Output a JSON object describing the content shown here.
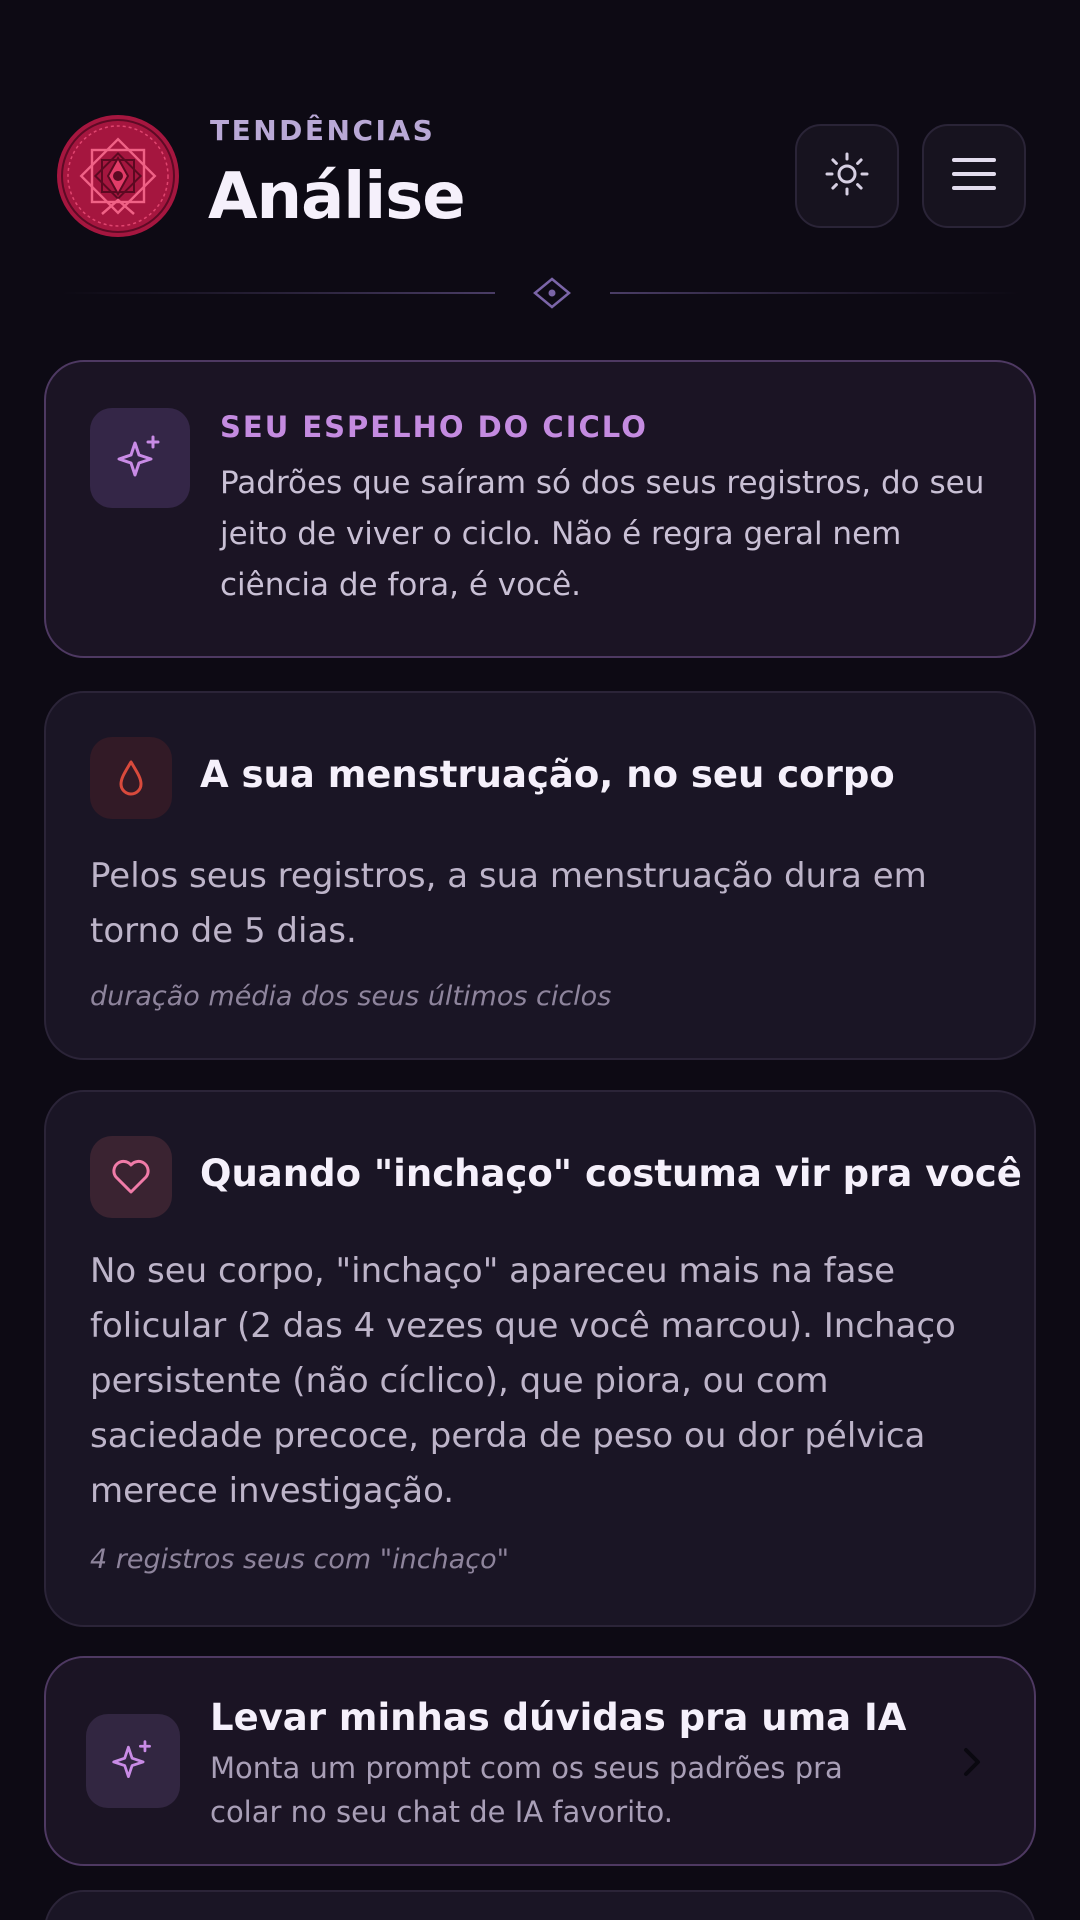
{
  "header": {
    "eyebrow": "TENDÊNCIAS",
    "title": "Análise",
    "theme_icon": "sun-icon",
    "menu_icon": "hamburger-menu-icon"
  },
  "mirror_card": {
    "icon": "sparkles-icon",
    "heading": "SEU ESPELHO DO CICLO",
    "text": "Padrões que saíram só dos seus registros, do seu jeito de viver o ciclo. Não é regra geral nem ciência de fora, é você."
  },
  "period_card": {
    "icon": "drop-icon",
    "title": "A sua menstruação, no seu corpo",
    "body": "Pelos seus registros, a sua menstruação dura em torno de 5 dias.",
    "note": "duração média dos seus últimos ciclos"
  },
  "bloat_card": {
    "icon": "heart-icon",
    "title": "Quando \"inchaço\" costuma vir pra você",
    "body": "No seu corpo, \"inchaço\" apareceu mais na fase folicular (2 das 4 vezes que você marcou). Inchaço persistente (não cíclico), que piora, ou com saciedade precoce, perda de peso ou dor pélvica merece investigação.",
    "note": "4 registros seus com \"inchaço\""
  },
  "ai_card": {
    "icon": "sparkles-icon",
    "title": "Levar minhas dúvidas pra uma IA",
    "subtitle": "Monta um prompt com os seus padrões pra colar no seu chat de IA favorito."
  },
  "colors": {
    "background": "#0d0a14",
    "accent": "#c48be0",
    "brand": "#c2174a",
    "period": "#d94a3c",
    "heart": "#f07ba8"
  }
}
